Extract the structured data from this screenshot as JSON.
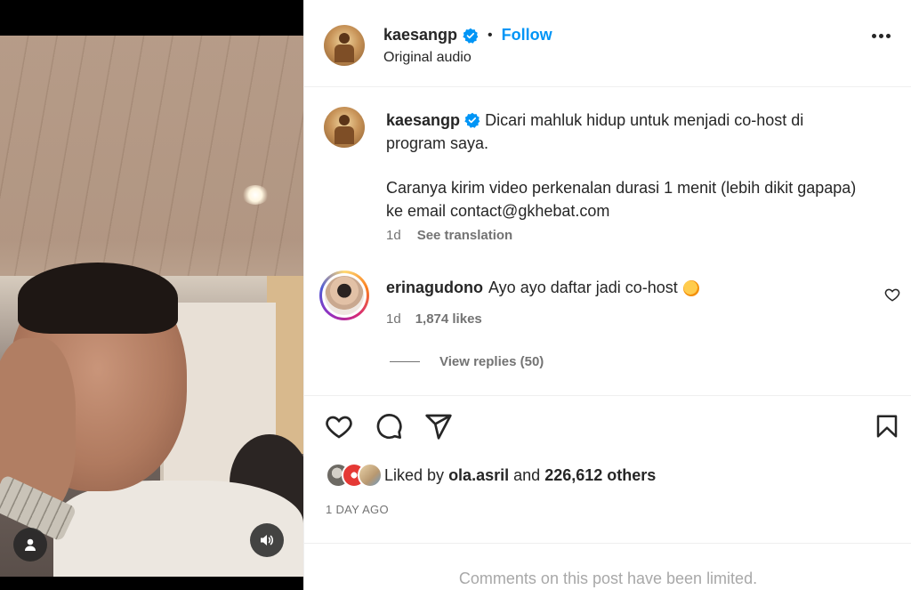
{
  "post": {
    "username": "kaesangp",
    "follow_label": "Follow",
    "separator": "•",
    "audio_label": "Original audio"
  },
  "caption": {
    "username": "kaesangp",
    "line1": "Dicari mahluk hidup untuk menjadi co-host di program saya.",
    "line2": "Caranya kirim video perkenalan durasi 1 menit (lebih dikit gapapa) ke email contact@gkhebat.com",
    "time": "1d",
    "translation_label": "See translation"
  },
  "comment": {
    "username": "erinagudono",
    "text": "Ayo ayo daftar jadi co-host",
    "emoji": "partying-face-emoji",
    "time": "1d",
    "likes": "1,874 likes",
    "view_replies": "View replies (50)"
  },
  "likes": {
    "prefix": "Liked by",
    "user": "ola.asril",
    "and": "and",
    "count": "226,612 others"
  },
  "date": "1 DAY AGO",
  "comments_limited": "Comments on this post have been limited.",
  "icons": {
    "like": "heart-icon",
    "comment": "comment-icon",
    "share": "share-icon",
    "save": "bookmark-icon",
    "more": "more-options-icon",
    "verified": "verified-badge-icon",
    "user": "user-icon",
    "audio": "speaker-icon"
  },
  "colors": {
    "accent": "#0095f6",
    "text": "#262626",
    "muted": "#737373",
    "limited": "#a8a8a8"
  }
}
